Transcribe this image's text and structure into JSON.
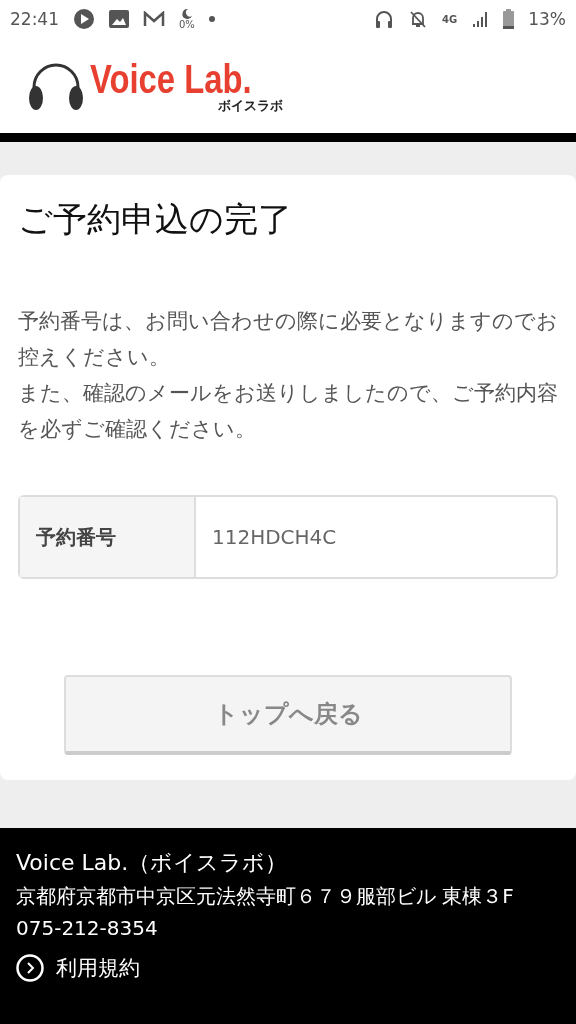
{
  "status_bar": {
    "time": "22:41",
    "dnd_level": "0%",
    "network": "4G",
    "battery": "13%"
  },
  "header": {
    "logo_text": "Voice Lab.",
    "logo_kana": "ボイスラボ"
  },
  "card": {
    "title": "ご予約申込の完了",
    "paragraphs": [
      "予約番号は、お問い合わせの際に必要となりますのでお控えください。",
      "また、確認のメールをお送りしましたので、ご予約内容を必ずご確認ください。"
    ],
    "reservation": {
      "label": "予約番号",
      "value": "112HDCH4C"
    },
    "button": "トップへ戻る"
  },
  "footer": {
    "name": "Voice Lab.（ボイスラボ）",
    "address": "京都府京都市中京区元法然寺町６７９服部ビル 東棟３F",
    "phone": "075-212-8354",
    "links": [
      "利用規約"
    ]
  }
}
